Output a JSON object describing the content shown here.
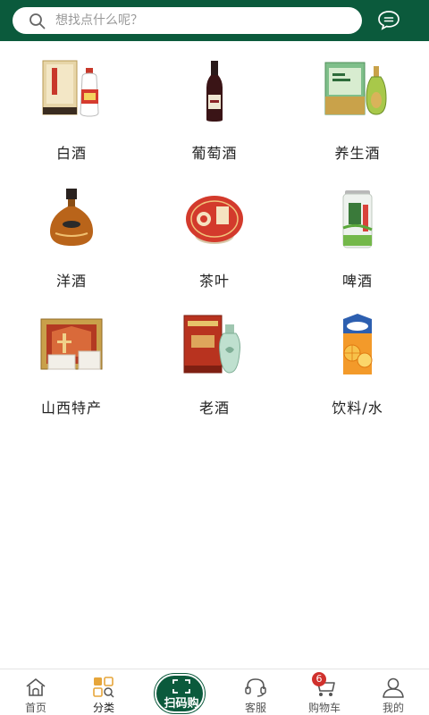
{
  "search": {
    "placeholder": "想找点什么呢？"
  },
  "colors": {
    "brand": "#0b5a3c",
    "badge": "#d0312d"
  },
  "categories": [
    {
      "label": "白酒",
      "icon": "baijiu-bottle-image"
    },
    {
      "label": "葡萄酒",
      "icon": "wine-bottle-image"
    },
    {
      "label": "养生酒",
      "icon": "health-wine-image"
    },
    {
      "label": "洋酒",
      "icon": "brandy-bottle-image"
    },
    {
      "label": "茶叶",
      "icon": "tea-cake-image"
    },
    {
      "label": "啤酒",
      "icon": "beer-can-image"
    },
    {
      "label": "山西特产",
      "icon": "shanxi-specialty-image"
    },
    {
      "label": "老酒",
      "icon": "old-liquor-image"
    },
    {
      "label": "饮料/水",
      "icon": "juice-carton-image"
    }
  ],
  "tabbar": {
    "home": "首页",
    "category": "分类",
    "scan": "扫码购",
    "service": "客服",
    "cart": "购物车",
    "cart_count": "6",
    "mine": "我的"
  }
}
